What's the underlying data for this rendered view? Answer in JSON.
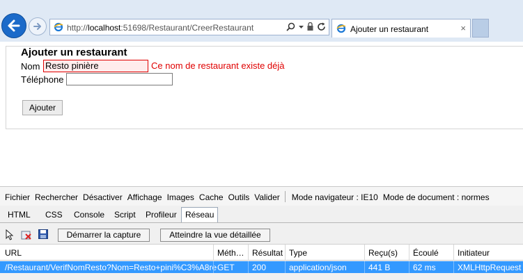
{
  "browser": {
    "url_prefix": "http://",
    "url_host": "localhost",
    "url_rest": ":51698/Restaurant/CreerRestaurant",
    "tab_title": "Ajouter un restaurant",
    "tab_close": "×",
    "address_tools": [
      "search-icon",
      "dropdown-icon",
      "lock-icon",
      "refresh-icon"
    ]
  },
  "page": {
    "heading": "Ajouter un restaurant",
    "name_label": "Nom",
    "name_value": "Resto pinière",
    "name_error": "Ce nom de restaurant existe déjà",
    "phone_label": "Téléphone",
    "phone_value": "",
    "submit_label": "Ajouter"
  },
  "devtools": {
    "menu": [
      "Fichier",
      "Rechercher",
      "Désactiver",
      "Affichage",
      "Images",
      "Cache",
      "Outils",
      "Valider"
    ],
    "browser_mode": "Mode navigateur : IE10",
    "document_mode": "Mode de document : normes",
    "tabs": [
      "HTML",
      "CSS",
      "Console",
      "Script",
      "Profileur",
      "Réseau"
    ],
    "active_tab": "Réseau",
    "start_capture": "Démarrer la capture",
    "detailed_view": "Atteindre la vue détaillée",
    "columns": [
      "URL",
      "Méth…",
      "Résultat",
      "Type",
      "Reçu(s)",
      "Écoulé",
      "Initiateur"
    ],
    "rows": [
      {
        "url": "/Restaurant/VerifNomResto?Nom=Resto+pini%C3%A8re",
        "method": "GET",
        "result": "200",
        "type": "application/json",
        "received": "441 B",
        "elapsed": "62 ms",
        "initiator": "XMLHttpRequest"
      }
    ]
  },
  "colors": {
    "accent": "#1b6ac9",
    "error": "#e00000",
    "selection": "#3399ff"
  }
}
